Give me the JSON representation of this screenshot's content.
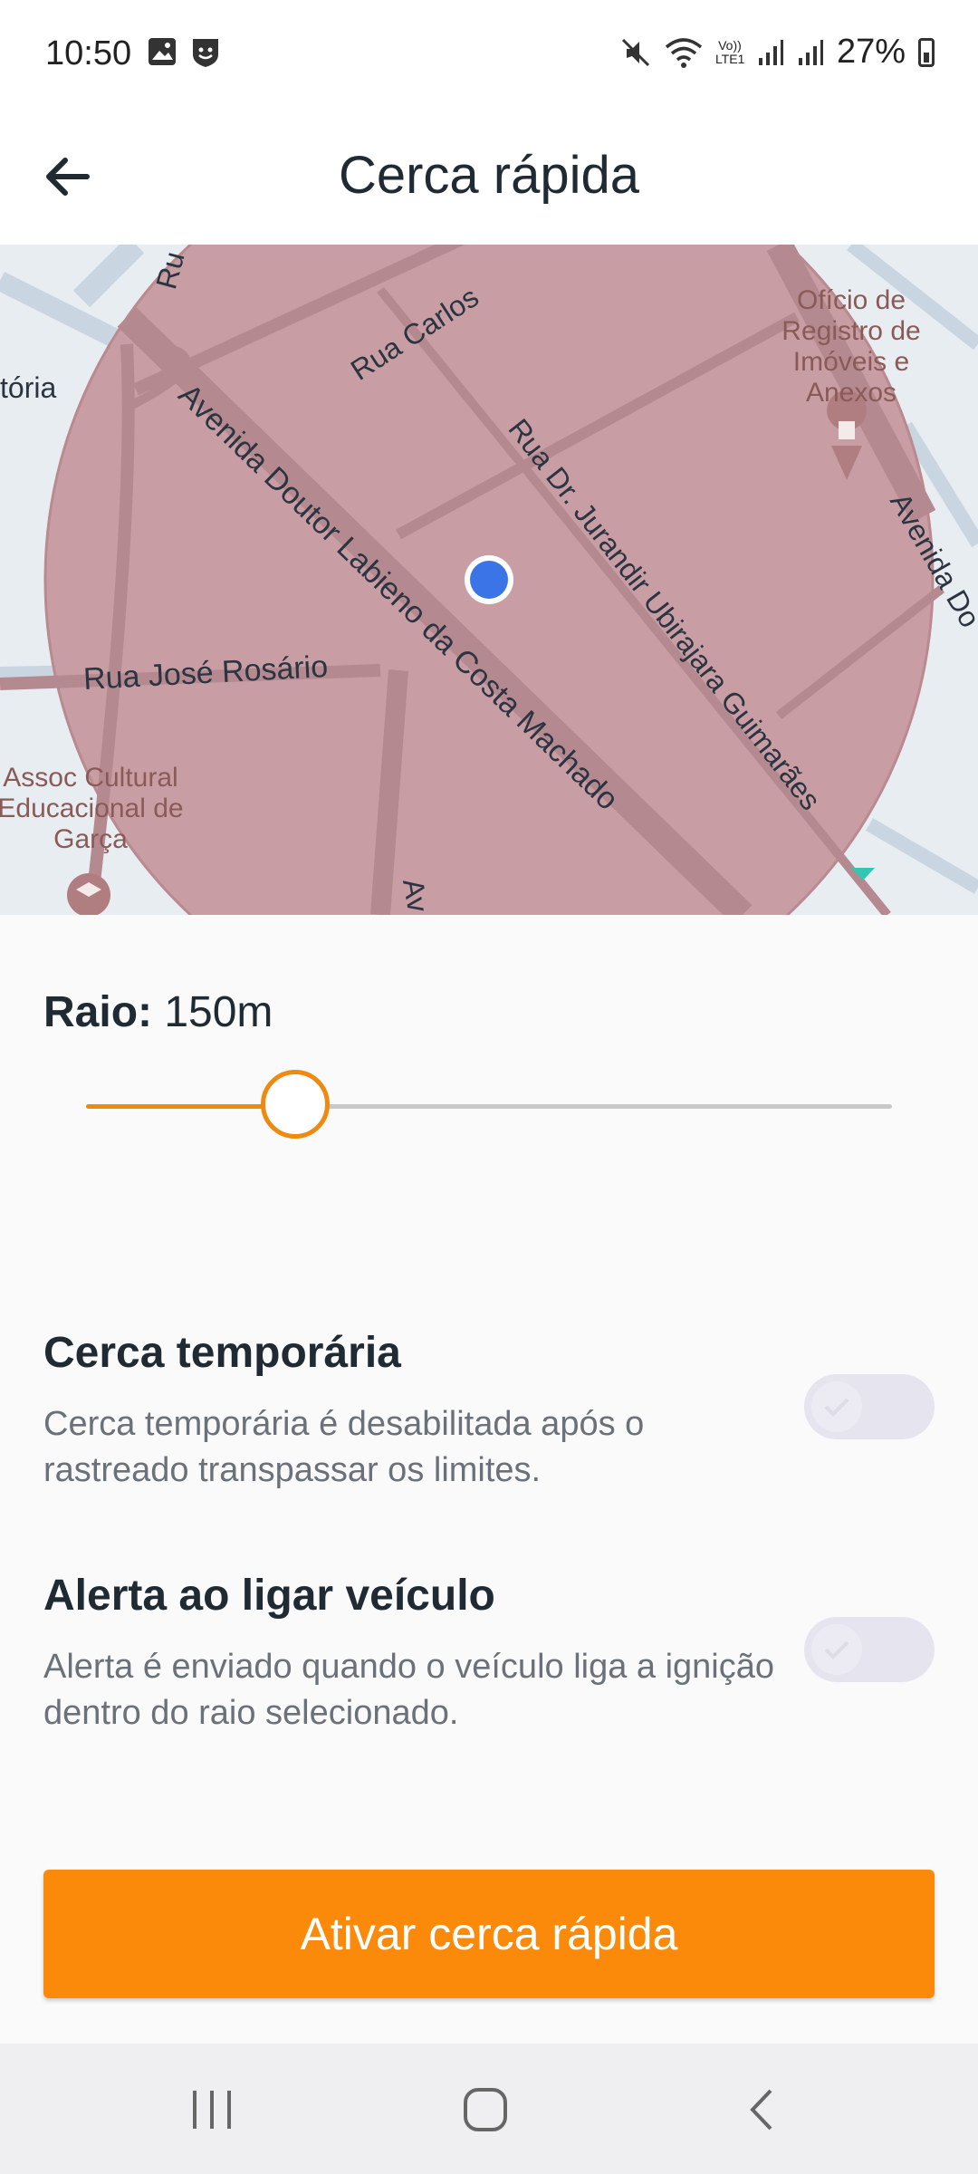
{
  "status_bar": {
    "time": "10:50",
    "battery": "27%",
    "icons": [
      "gallery-icon",
      "shield-face-icon",
      "mute-icon",
      "wifi-icon",
      "volte-icon",
      "signal-icon",
      "signal-icon",
      "battery-icon"
    ],
    "volte_text": "Vo)) LTE1"
  },
  "header": {
    "title": "Cerca rápida",
    "back_icon": "arrow-left-icon"
  },
  "map": {
    "streets": [
      "Rua Carlos",
      "Avenida Doutor Labieno da Costa Machado",
      "Rua Dr. Jurandir Ubirajara Guimarães",
      "Rua José Rosário",
      "Avenida Do",
      "Ru",
      "tória",
      "Av"
    ],
    "pois": [
      "Ofício de Registro de Imóveis e Anexos",
      "Assoc Cultural Educacional de Garça"
    ],
    "provider": "here",
    "colors": {
      "fence": "#c89ea4",
      "fence_border": "#b98a90",
      "marker": "#3b74e6"
    }
  },
  "radius": {
    "label": "Raio:",
    "value": "150m",
    "slider_fraction": 0.26
  },
  "settings": [
    {
      "title": "Cerca temporária",
      "description": "Cerca temporária é desabilitada após o rastreado transpassar os limites.",
      "enabled": false
    },
    {
      "title": "Alerta ao ligar veículo",
      "description": "Alerta é enviado quando o veículo liga a ignição dentro do raio selecionado.",
      "enabled": false
    }
  ],
  "action": {
    "label": "Ativar cerca rápida",
    "color": "#fb8a0a"
  },
  "nav": {
    "recent_icon": "recent-apps-icon",
    "home_icon": "home-icon",
    "back_icon": "back-chevron-icon"
  }
}
